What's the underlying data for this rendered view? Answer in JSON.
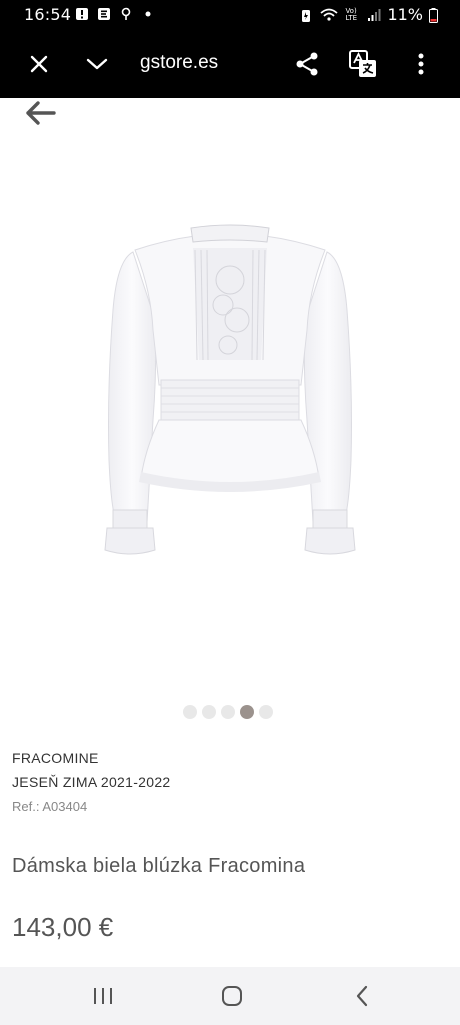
{
  "status_bar": {
    "time": "16:54",
    "battery_percent": "11%",
    "network_label": "Vo) LTE",
    "icons": [
      "alert-icon",
      "e-icon",
      "location-icon",
      "dot-icon",
      "battery-saver-icon",
      "wifi-icon",
      "signal-icon",
      "battery-icon"
    ]
  },
  "browser": {
    "url_text": "gstore.es",
    "icons": [
      "close-icon",
      "chevron-down-icon",
      "share-icon",
      "translate-icon",
      "more-vert-icon"
    ]
  },
  "product": {
    "brand": "FRACOMINE",
    "season": "JESEŇ ZIMA 2021-2022",
    "ref_label": "Ref.: A03404",
    "title": "Dámska biela blúzka Fracomina",
    "price": "143,00 €",
    "image_alt": "white blouse",
    "carousel": {
      "total": 5,
      "active_index": 3
    }
  },
  "nav": {
    "icons": [
      "recents-icon",
      "home-icon",
      "back-icon"
    ]
  },
  "colors": {
    "bar_bg": "#000000",
    "nav_bg": "#f3f3f5",
    "dot_active": "#9b928d",
    "dot_inactive": "#e8e8e8",
    "text_primary": "#333333",
    "text_muted": "#888888"
  }
}
